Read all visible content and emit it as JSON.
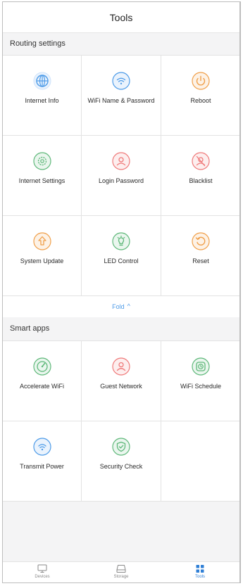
{
  "header": {
    "title": "Tools"
  },
  "routing_settings": {
    "title": "Routing settings",
    "items": [
      {
        "label": "Internet Info",
        "icon": "globe-icon",
        "color": "#4d9be8"
      },
      {
        "label": "WiFi Name & Password",
        "icon": "wifi-icon",
        "color": "#4d9be8"
      },
      {
        "label": "Reboot",
        "icon": "power-icon",
        "color": "#f0a04b"
      },
      {
        "label": "Internet Settings",
        "icon": "gear-icon",
        "color": "#5fb87a"
      },
      {
        "label": "Login Password",
        "icon": "user-lock-icon",
        "color": "#ef7a7a"
      },
      {
        "label": "Blacklist",
        "icon": "blocked-user-icon",
        "color": "#ef7a7a"
      },
      {
        "label": "System Update",
        "icon": "upload-arrow-icon",
        "color": "#f0a04b"
      },
      {
        "label": "LED Control",
        "icon": "lightbulb-icon",
        "color": "#5fb87a"
      },
      {
        "label": "Reset",
        "icon": "reset-arrow-icon",
        "color": "#f0a04b"
      }
    ],
    "fold_label": "Fold",
    "fold_chevron": "^"
  },
  "smart_apps": {
    "title": "Smart apps",
    "items": [
      {
        "label": "Accelerate WiFi",
        "icon": "speedometer-icon",
        "color": "#5fb87a"
      },
      {
        "label": "Guest Network",
        "icon": "guest-user-icon",
        "color": "#ef7a7a"
      },
      {
        "label": "WiFi Schedule",
        "icon": "clock-icon",
        "color": "#5fb87a"
      },
      {
        "label": "Transmit Power",
        "icon": "signal-icon",
        "color": "#4d9be8"
      },
      {
        "label": "Security Check",
        "icon": "shield-icon",
        "color": "#5fb87a"
      }
    ]
  },
  "bottom_nav": {
    "items": [
      {
        "label": "Devices",
        "icon": "monitor-icon",
        "active": false
      },
      {
        "label": "Storage",
        "icon": "storage-icon",
        "active": false
      },
      {
        "label": "Tools",
        "icon": "grid-icon",
        "active": true
      }
    ],
    "active_color": "#2f7fd6",
    "inactive_color": "#8a8a8a"
  }
}
